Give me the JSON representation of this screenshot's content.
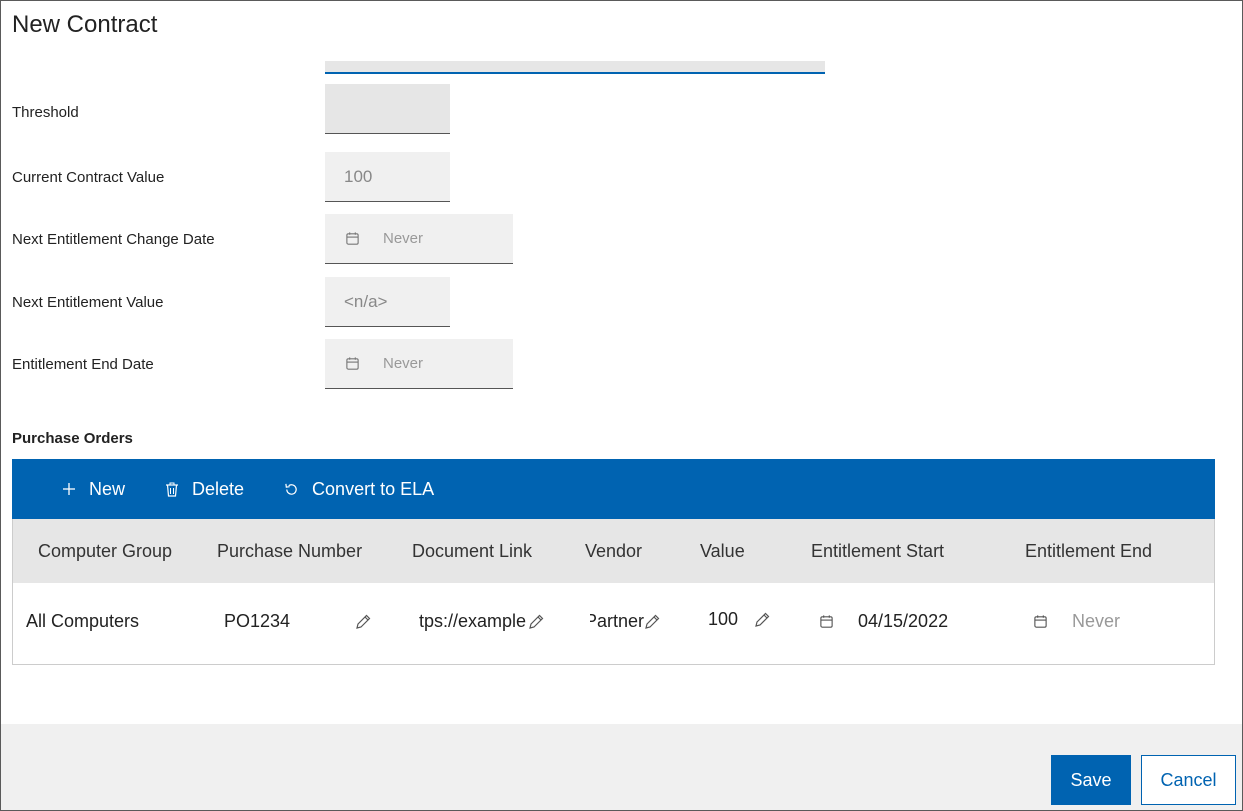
{
  "dialog": {
    "title": "New Contract"
  },
  "form": {
    "threshold_label": "Threshold",
    "threshold_value": "",
    "current_contract_value_label": "Current Contract Value",
    "current_contract_value": "100",
    "next_entitlement_change_date_label": "Next Entitlement Change Date",
    "next_entitlement_change_date": "Never",
    "next_entitlement_value_label": "Next Entitlement Value",
    "next_entitlement_value": "<n/a>",
    "entitlement_end_date_label": "Entitlement End Date",
    "entitlement_end_date": "Never"
  },
  "purchase_orders": {
    "title": "Purchase Orders",
    "toolbar": {
      "new_label": "New",
      "delete_label": "Delete",
      "convert_label": "Convert to ELA"
    },
    "columns": [
      "Computer Group",
      "Purchase Number",
      "Document Link",
      "Vendor",
      "Value",
      "Entitlement Start",
      "Entitlement End"
    ],
    "rows": [
      {
        "computer_group": "All Computers",
        "purchase_number": "PO1234",
        "document_link": "tps://example",
        "vendor": "Partner",
        "value": "100",
        "entitlement_start": "04/15/2022",
        "entitlement_end": "Never"
      }
    ]
  },
  "footer": {
    "save_label": "Save",
    "cancel_label": "Cancel"
  },
  "colors": {
    "accent": "#0063b1",
    "header_bg": "#e6e6e6",
    "field_bg": "#f0f0f0"
  },
  "icons": [
    "calendar-icon",
    "plus-icon",
    "trash-icon",
    "refresh-icon",
    "pencil-icon"
  ]
}
